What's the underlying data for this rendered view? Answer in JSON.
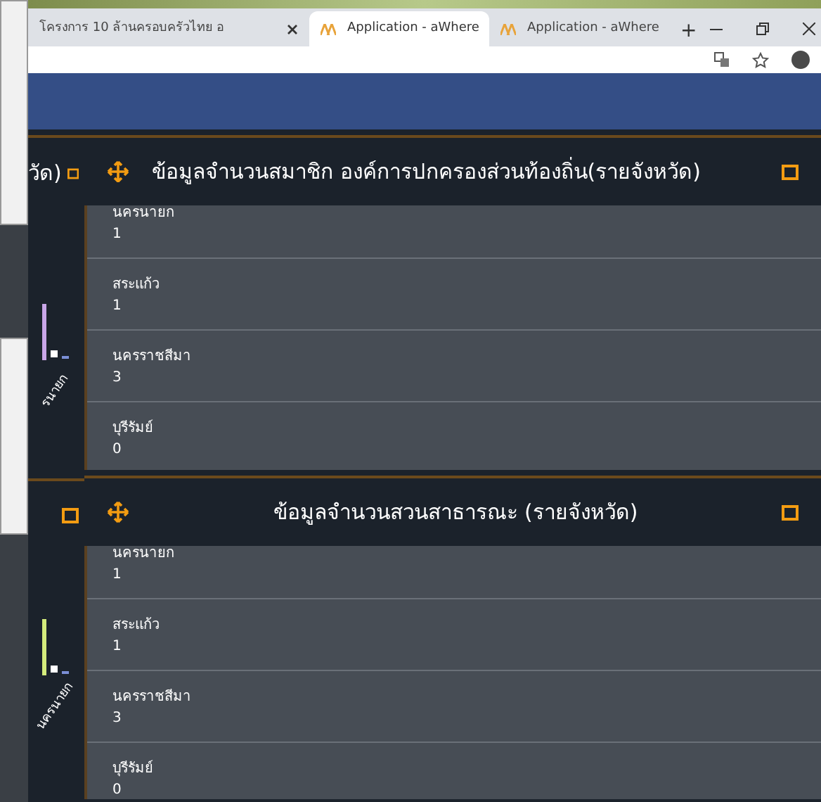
{
  "browser": {
    "tabs": [
      {
        "title": "โครงการ 10 ล้านครอบครัวไทย อ",
        "selected": false
      },
      {
        "title": "Application - aWhere",
        "selected": true
      },
      {
        "title": "Application - aWhere",
        "selected": false
      }
    ],
    "new_tab": "+"
  },
  "side_panels": [
    {
      "title": "วัด)",
      "axis_label": "รนายก"
    },
    {
      "axis_label": "นครนายก"
    }
  ],
  "panels": [
    {
      "title": "ข้อมูลจำนวนสมาชิก องค์การปกครองส่วนท้องถิ่น(รายจังหวัด)",
      "rows": [
        {
          "name": "นครนายก",
          "value": "1"
        },
        {
          "name": "สระแก้ว",
          "value": "1"
        },
        {
          "name": "นครราชสีมา",
          "value": "3"
        },
        {
          "name": "บุรีรัมย์",
          "value": "0"
        }
      ]
    },
    {
      "title": "ข้อมูลจำนวนสวนสาธารณะ (รายจังหวัด)",
      "rows": [
        {
          "name": "นครนายก",
          "value": "1"
        },
        {
          "name": "สระแก้ว",
          "value": "1"
        },
        {
          "name": "นครราชสีมา",
          "value": "3"
        },
        {
          "name": "บุรีรัมย์",
          "value": "0"
        }
      ]
    }
  ]
}
